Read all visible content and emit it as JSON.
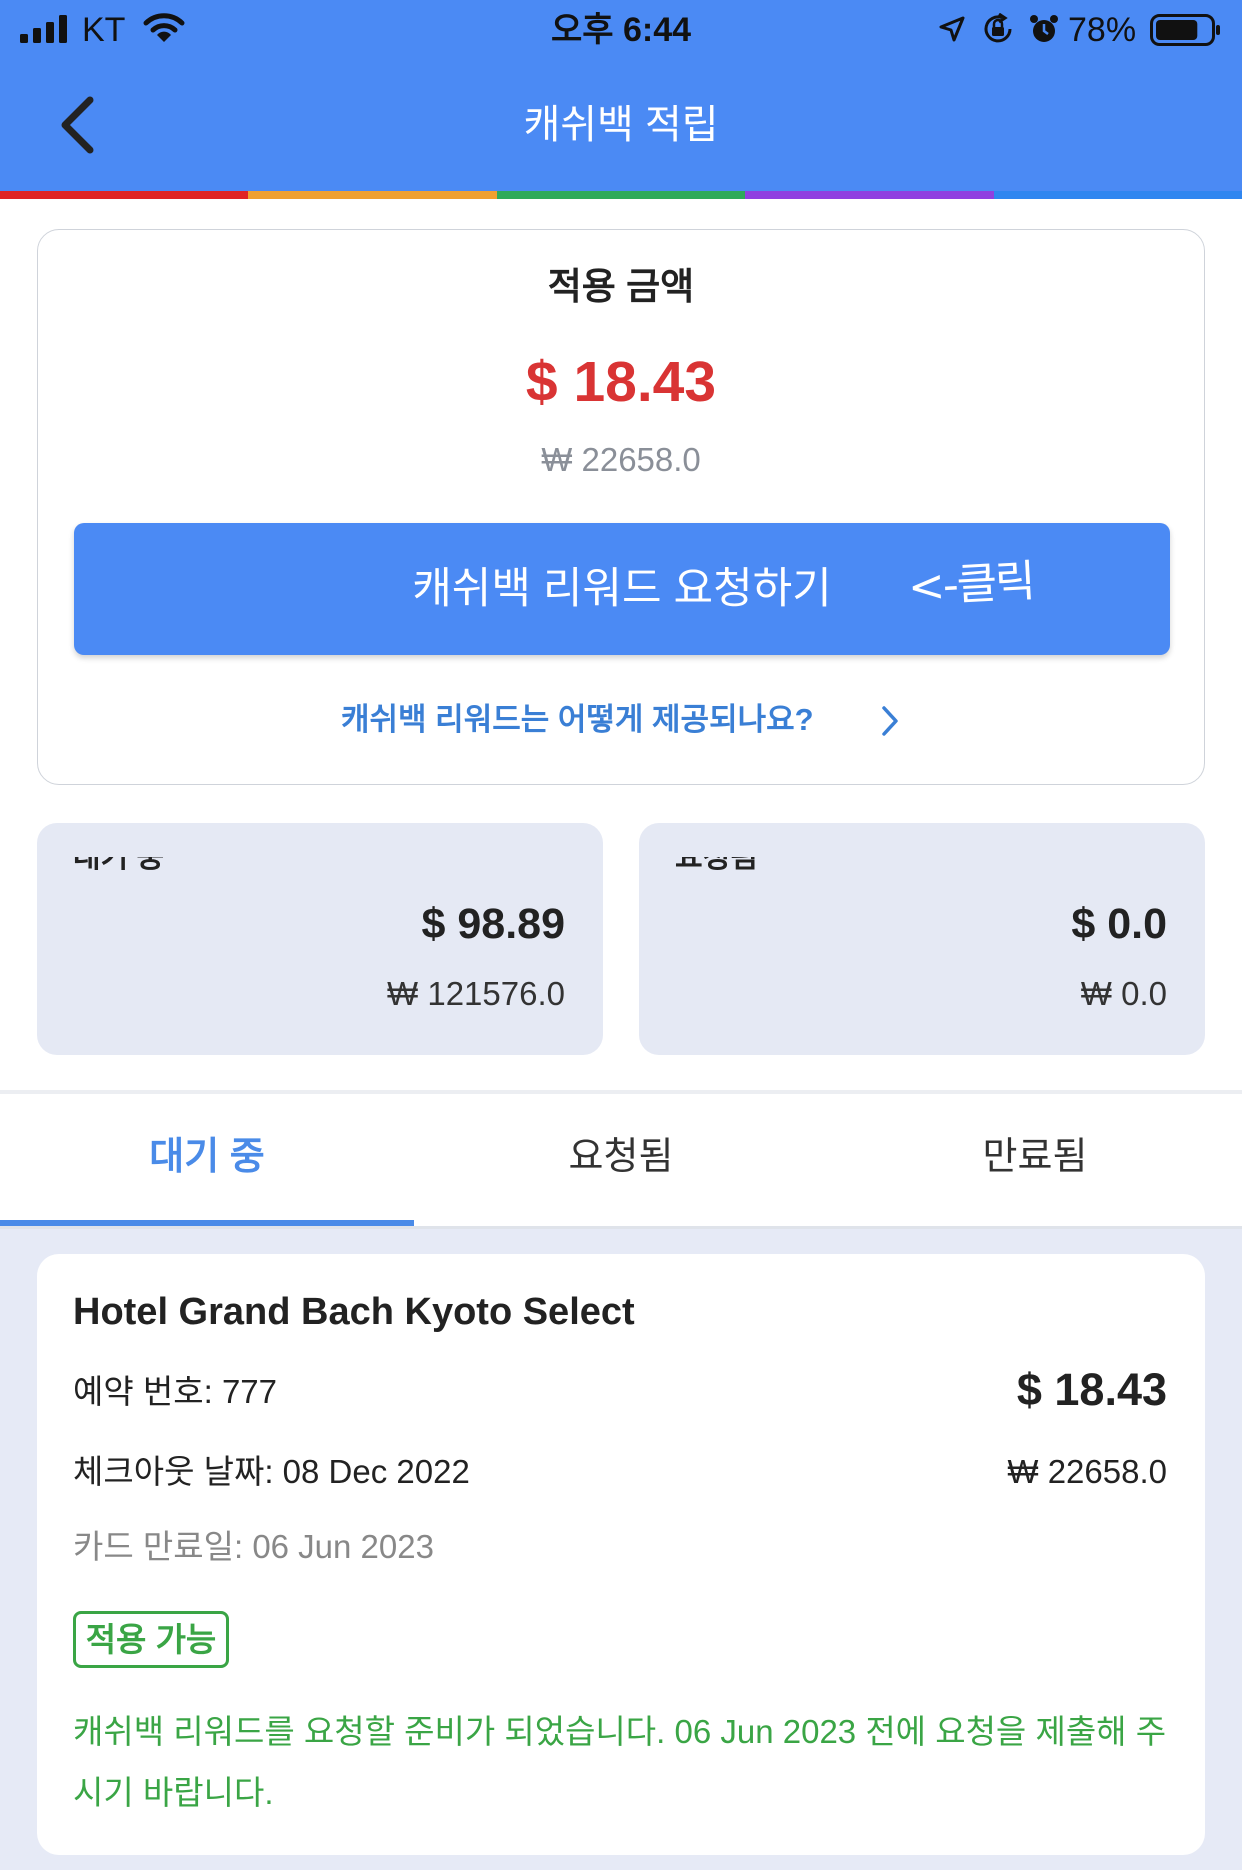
{
  "status_bar": {
    "carrier": "KT",
    "time": "오후 6:44",
    "battery_text": "78%",
    "battery_level": 0.78
  },
  "header": {
    "title": "캐쉬백 적립",
    "back_icon": "chevron-left-icon"
  },
  "summary": {
    "label": "적용 금액",
    "usd": "$ 18.43",
    "krw": "₩ 22658.0",
    "button_label": "캐쉬백 리워드 요청하기",
    "annotation": "<-클릭",
    "help_link": "캐쉬백 리워드는 어떻게 제공되나요?"
  },
  "stats": [
    {
      "label": "대기 중",
      "usd": "$ 98.89",
      "krw": "₩ 121576.0"
    },
    {
      "label": "요청됨",
      "usd": "$ 0.0",
      "krw": "₩ 0.0"
    }
  ],
  "tabs": [
    {
      "label": "대기 중",
      "active": true
    },
    {
      "label": "요청됨",
      "active": false
    },
    {
      "label": "만료됨",
      "active": false
    }
  ],
  "booking": {
    "hotel": "Hotel Grand Bach Kyoto Select",
    "booking_no_label": "예약 번호:",
    "booking_no": "777",
    "checkout_label": "체크아웃 날짜:",
    "checkout": "08 Dec 2022",
    "card_expiry_label": "카드 만료일:",
    "card_expiry": "06 Jun 2023",
    "usd": "$ 18.43",
    "krw": "₩ 22658.0",
    "badge": "적용 가능",
    "message": "캐쉬백 리워드를 요청할 준비가 되었습니다. 06 Jun 2023 전에 요청을 제출해 주시기 바랍니다."
  },
  "colors": {
    "header": "#4b8af4",
    "accent": "#4a8be8",
    "amount_red": "#d93434",
    "success_green": "#3aa545",
    "rainbow": [
      "#e02424",
      "#f0a030",
      "#2eaa5a",
      "#9040e0",
      "#2f86f0"
    ]
  }
}
